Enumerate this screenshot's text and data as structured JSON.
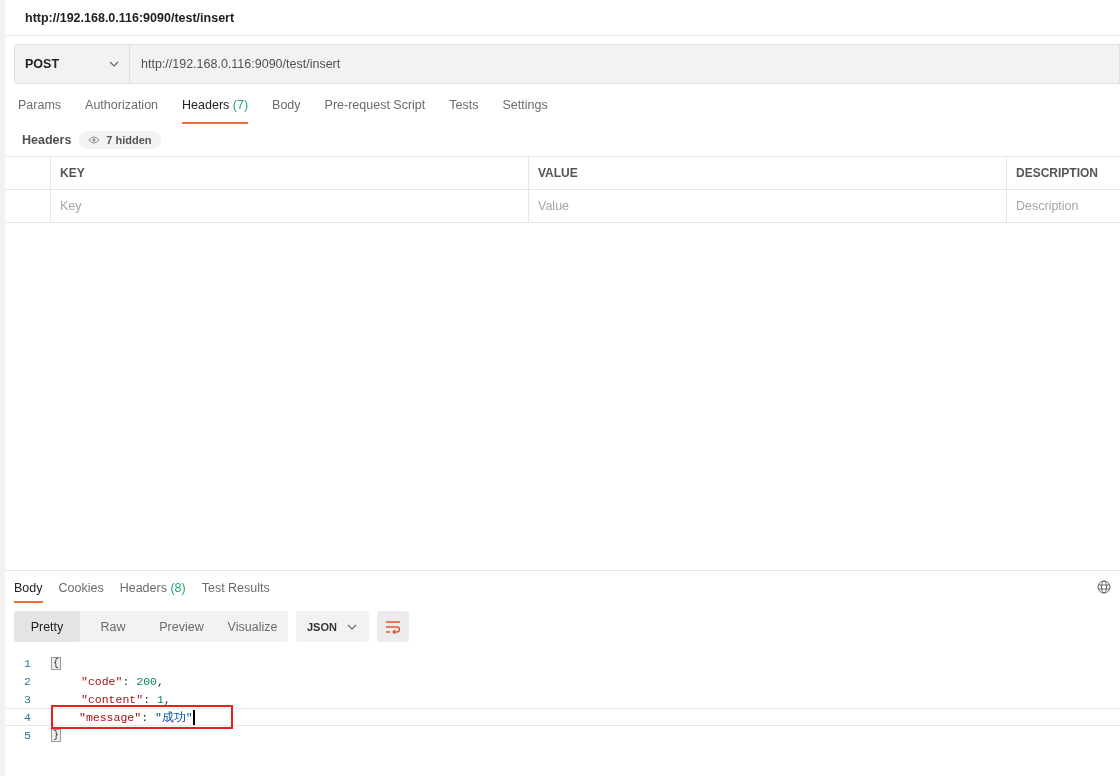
{
  "title": "http://192.168.0.116:9090/test/insert",
  "request": {
    "method": "POST",
    "url": "http://192.168.0.116:9090/test/insert"
  },
  "request_tabs": [
    {
      "label": "Params",
      "selected": false
    },
    {
      "label": "Authorization",
      "selected": false
    },
    {
      "label": "Headers",
      "count": "(7)",
      "selected": true
    },
    {
      "label": "Body",
      "selected": false
    },
    {
      "label": "Pre-request Script",
      "selected": false
    },
    {
      "label": "Tests",
      "selected": false
    },
    {
      "label": "Settings",
      "selected": false
    }
  ],
  "headers_section": {
    "label": "Headers",
    "hidden_badge": "7 hidden"
  },
  "table": {
    "columns": [
      "KEY",
      "VALUE",
      "DESCRIPTION"
    ],
    "placeholders": [
      "Key",
      "Value",
      "Description"
    ]
  },
  "response_tabs": [
    {
      "label": "Body",
      "selected": true
    },
    {
      "label": "Cookies",
      "selected": false
    },
    {
      "label": "Headers",
      "count": "(8)",
      "selected": false
    },
    {
      "label": "Test Results",
      "selected": false
    }
  ],
  "view_modes": [
    {
      "label": "Pretty",
      "selected": true
    },
    {
      "label": "Raw",
      "selected": false
    },
    {
      "label": "Preview",
      "selected": false
    },
    {
      "label": "Visualize",
      "selected": false
    }
  ],
  "format": "JSON",
  "code_lines": [
    {
      "number": "1",
      "active": false,
      "annotated": false,
      "tokens": [
        {
          "kind": "fold",
          "text": "{"
        }
      ]
    },
    {
      "number": "2",
      "active": false,
      "annotated": false,
      "tokens": [
        {
          "kind": "key",
          "text": "\"code\""
        },
        {
          "kind": "punct",
          "text": ": "
        },
        {
          "kind": "number",
          "text": "200"
        },
        {
          "kind": "punct",
          "text": ","
        }
      ]
    },
    {
      "number": "3",
      "active": false,
      "annotated": false,
      "tokens": [
        {
          "kind": "key",
          "text": "\"content\""
        },
        {
          "kind": "punct",
          "text": ": "
        },
        {
          "kind": "number",
          "text": "1"
        },
        {
          "kind": "punct",
          "text": ","
        }
      ]
    },
    {
      "number": "4",
      "active": true,
      "annotated": true,
      "tokens": [
        {
          "kind": "key",
          "text": "\"message\""
        },
        {
          "kind": "punct",
          "text": ": "
        },
        {
          "kind": "string",
          "text": "\"成功\""
        }
      ]
    },
    {
      "number": "5",
      "active": false,
      "annotated": false,
      "tokens": [
        {
          "kind": "fold",
          "text": "}"
        }
      ]
    }
  ]
}
